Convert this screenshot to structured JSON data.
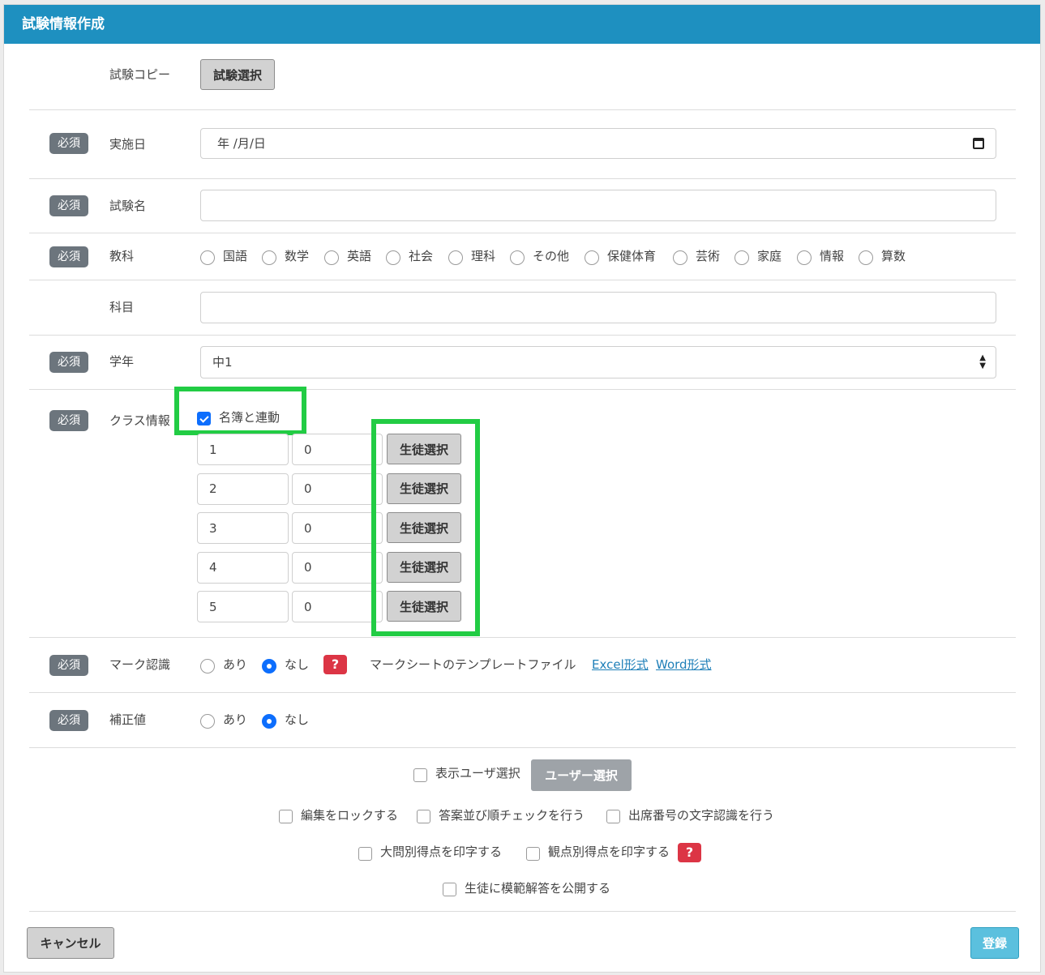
{
  "header": {
    "title": "試験情報作成"
  },
  "required_badge": "必須",
  "copy": {
    "label": "試験コピー",
    "button": "試験選択"
  },
  "date": {
    "label": "実施日",
    "placeholder": "年 /月/日"
  },
  "exam_name": {
    "label": "試験名",
    "value": ""
  },
  "subject": {
    "label": "教科",
    "options": [
      "国語",
      "数学",
      "英語",
      "社会",
      "理科",
      "その他",
      "保健体育",
      "芸術",
      "家庭",
      "情報",
      "算数"
    ]
  },
  "course": {
    "label": "科目",
    "value": ""
  },
  "grade": {
    "label": "学年",
    "value": "中1"
  },
  "class_info": {
    "label": "クラス情報",
    "link_label": "名簿と連動",
    "link_checked": true,
    "rows": [
      {
        "class": "1",
        "count": "0",
        "button": "生徒選択"
      },
      {
        "class": "2",
        "count": "0",
        "button": "生徒選択"
      },
      {
        "class": "3",
        "count": "0",
        "button": "生徒選択"
      },
      {
        "class": "4",
        "count": "0",
        "button": "生徒選択"
      },
      {
        "class": "5",
        "count": "0",
        "button": "生徒選択"
      }
    ]
  },
  "mark": {
    "label": "マーク認識",
    "yes": "あり",
    "no": "なし",
    "selected": "なし",
    "help": "?",
    "template_text": "マークシートのテンプレートファイル",
    "excel_link": "Excel形式",
    "word_link": "Word形式"
  },
  "correction": {
    "label": "補正値",
    "yes": "あり",
    "no": "なし",
    "selected": "なし"
  },
  "options": {
    "display_user": "表示ユーザ選択",
    "user_select_button": "ユーザー選択",
    "lock_edit": "編集をロックする",
    "order_check": "答案並び順チェックを行う",
    "attendance_ocr": "出席番号の文字認識を行う",
    "print_section_score": "大問別得点を印字する",
    "print_viewpoint_score": "観点別得点を印字する",
    "help": "?",
    "publish_model_answer": "生徒に模範解答を公開する"
  },
  "footer": {
    "cancel": "キャンセル",
    "register": "登録"
  },
  "colors": {
    "header": "#1e90c0",
    "highlight": "#22cc44",
    "primary": "#0d6efd",
    "danger": "#dc3545",
    "register": "#5bc0de"
  }
}
